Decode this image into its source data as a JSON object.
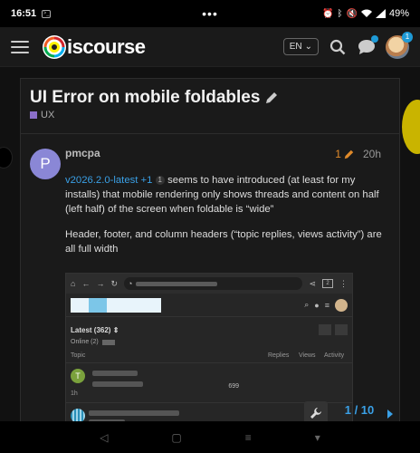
{
  "status_bar": {
    "time": "16:51",
    "dots": "•••",
    "battery": "49%"
  },
  "header": {
    "logo_text": "iscourse",
    "lang_label": "EN",
    "notification_count": "1"
  },
  "topic": {
    "title": "UI Error on mobile foldables",
    "category": "UX",
    "category_color": "#8b6fc9"
  },
  "post": {
    "avatar_letter": "P",
    "avatar_color": "#8a87d6",
    "username": "pmcpa",
    "edit_count": "1",
    "age": "20h",
    "version_link": "v2026.2.0-latest +1",
    "link_count": "1",
    "para1_rest": " seems to have introduced (at least for my installs) that mobile rendering only shows threads and content on half (left half) of the screen when foldable is “wide”",
    "para2": "Header, footer, and column headers (“topic replies, views activity”) are all full width"
  },
  "embedded": {
    "latest_label": "Latest (362)",
    "online_label": "Online (2)",
    "columns": [
      "Topic",
      "Replies",
      "Views",
      "Activity"
    ],
    "row1_letter": "T",
    "row1_age": "1h",
    "row1_value": "699",
    "tab_count": "2"
  },
  "timeline": {
    "progress": "1 / 10"
  },
  "accent_color": "#3aa0e6"
}
